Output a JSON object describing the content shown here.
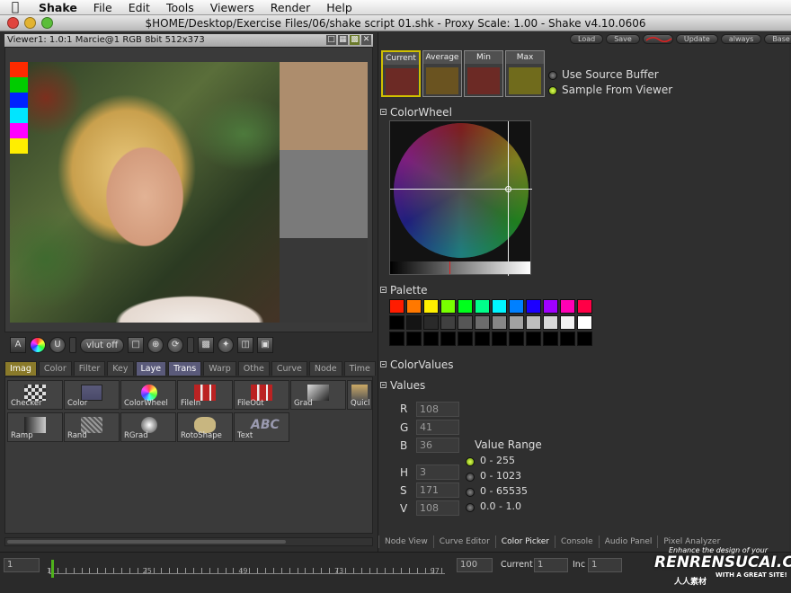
{
  "menubar": {
    "items": [
      "Shake",
      "File",
      "Edit",
      "Tools",
      "Viewers",
      "Render",
      "Help"
    ]
  },
  "window": {
    "title": "$HOME/Desktop/Exercise Files/06/shake script 01.shk - Proxy Scale: 1.00 - Shake v4.10.0606"
  },
  "viewer": {
    "title": "Viewer1: 1.0:1  Marcie@1  RGB 8bit 512x373",
    "vlut_label": "vlut off",
    "side_swatches": [
      "#ff2a00",
      "#00cc00",
      "#0022ff",
      "#00e5ff",
      "#ff00ff",
      "#ffee00"
    ],
    "buffer_colors": [
      "#ad8d6d",
      "#7a7a7a",
      "#383838"
    ],
    "a_label": "A"
  },
  "tool_tabs": [
    "Imag",
    "Color",
    "Filter",
    "Key",
    "Laye",
    "Trans",
    "Warp",
    "Othe",
    "Curve",
    "Node",
    "Time"
  ],
  "tools": [
    {
      "label": "Checker"
    },
    {
      "label": "Color"
    },
    {
      "label": "ColorWheel"
    },
    {
      "label": "FileIn"
    },
    {
      "label": "FileOut"
    },
    {
      "label": "Grad"
    },
    {
      "label": "Quicl"
    },
    {
      "label": "Ramp"
    },
    {
      "label": "Rand"
    },
    {
      "label": "RGrad"
    },
    {
      "label": "RotoShape"
    },
    {
      "label": "Text"
    }
  ],
  "top_buttons": [
    "Load",
    "Save",
    "",
    "Update",
    "always",
    "Base"
  ],
  "color_picker": {
    "boxes": [
      {
        "label": "Current",
        "color": "#6c2a25"
      },
      {
        "label": "Average",
        "color": "#6a5320"
      },
      {
        "label": "Min",
        "color": "#6c2a25"
      },
      {
        "label": "Max",
        "color": "#706b1c"
      }
    ],
    "use_source_buffer": "Use Source Buffer",
    "sample_from_viewer": "Sample From Viewer"
  },
  "sections": {
    "colorwheel": "ColorWheel",
    "palette": "Palette",
    "colorvalues": "ColorValues",
    "values": "Values"
  },
  "palette": {
    "row1": [
      "#ff1c00",
      "#ff7800",
      "#ffef00",
      "#78ff00",
      "#00ff1c",
      "#00ff8a",
      "#00f5ff",
      "#0080ff",
      "#1c00ff",
      "#a000ff",
      "#ff00b4",
      "#ff0046"
    ],
    "row2": [
      "#000000",
      "#141414",
      "#2a2a2a",
      "#404040",
      "#565656",
      "#6c6c6c",
      "#868686",
      "#a2a2a2",
      "#bebebe",
      "#d8d8d8",
      "#f2f2f2",
      "#ffffff"
    ],
    "row3": [
      "#000000",
      "#000000",
      "#000000",
      "#000000",
      "#000000",
      "#000000",
      "#000000",
      "#000000",
      "#000000",
      "#000000",
      "#000000",
      "#000000"
    ]
  },
  "values": {
    "R": "108",
    "G": "41",
    "B": "36",
    "H": "3",
    "S": "171",
    "V": "108",
    "range_title": "Value Range",
    "ranges": [
      "0 - 255",
      "0 - 1023",
      "0 - 65535",
      "0.0 - 1.0"
    ]
  },
  "bottom_tabs": [
    "Node View",
    "Curve Editor",
    "Color Picker",
    "Console",
    "Audio Panel",
    "Pixel Analyzer"
  ],
  "timeline": {
    "start": "1",
    "ticks": [
      "1",
      "25",
      "49",
      "73",
      "97"
    ],
    "end": "100",
    "current_label": "Current",
    "current": "1",
    "inc_label": "Inc",
    "inc": "1"
  },
  "watermark": {
    "tagline": "Enhance the design of your",
    "brand": "RENRENSUCAI.COM",
    "cn": "人人素材",
    "site": "WITH A GREAT SITE!"
  }
}
